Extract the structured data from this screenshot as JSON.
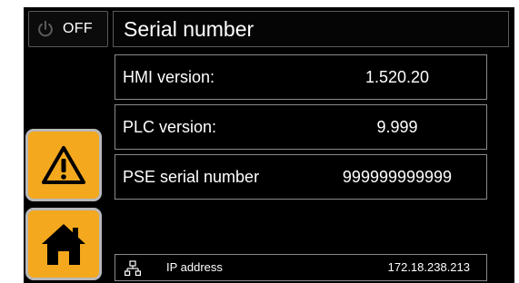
{
  "colors": {
    "accent": "#f3a81d",
    "background": "#000000",
    "text": "#ffffff"
  },
  "power": {
    "icon": "power-icon",
    "label": "OFF"
  },
  "title": "Serial number",
  "rows": [
    {
      "label": "HMI version:",
      "value": "1.520.20"
    },
    {
      "label": "PLC version:",
      "value": "9.999"
    },
    {
      "label": "PSE serial number",
      "value": "999999999999"
    }
  ],
  "side_buttons": {
    "warning_icon": "warning-icon",
    "home_icon": "home-icon"
  },
  "footer": {
    "icon": "network-icon",
    "label": "IP address",
    "value": "172.18.238.213"
  }
}
